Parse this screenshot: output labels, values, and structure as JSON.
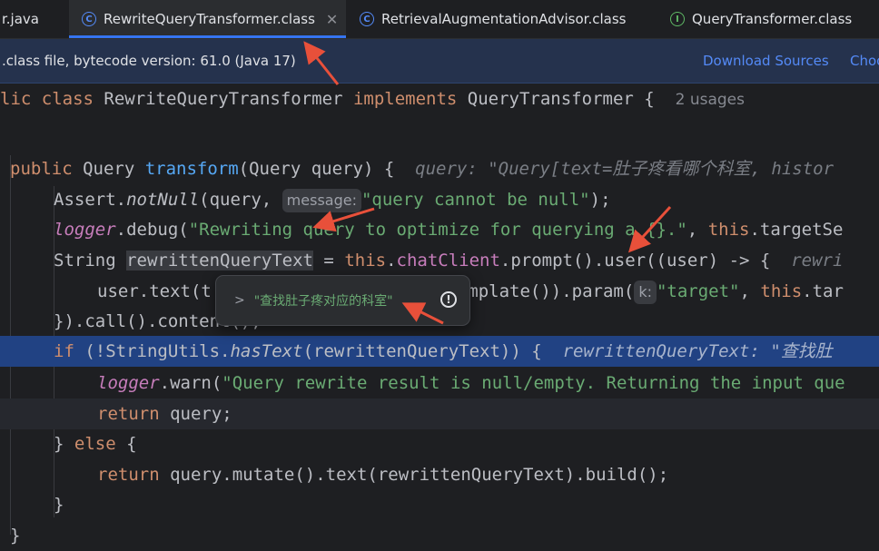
{
  "tabs": [
    {
      "label": "r.java",
      "icon": "java-file-icon"
    },
    {
      "label": "RewriteQueryTransformer.class",
      "icon": "class-icon",
      "active": true
    },
    {
      "label": "RetrievalAugmentationAdvisor.class",
      "icon": "class-icon"
    },
    {
      "label": "QueryTransformer.class",
      "icon": "interface-icon"
    }
  ],
  "infobar": {
    "message": ".class file, bytecode version: 61.0 (Java 17)",
    "download_sources": "Download Sources",
    "choose_sources": "Choo"
  },
  "code": {
    "l1": {
      "a": "lic ",
      "b": "class ",
      "c": "RewriteQueryTransformer ",
      "d": "implements ",
      "e": "QueryTransformer {",
      "usage": "2 usages"
    },
    "l3": {
      "a": "public ",
      "b": "Query ",
      "c": "transform",
      "d": "(Query query) {",
      "hint": "query: \"Query[text=肚子疼看哪个科室, histor"
    },
    "l4": {
      "a": "Assert.",
      "b": "notNull",
      "c": "(query, ",
      "chip": "message:",
      "d": "\"query cannot be null\"",
      "e": ");"
    },
    "l5": {
      "a": "logger",
      "b": ".debug(",
      "c": "\"Rewriting query to optimize for querying a {}.\"",
      "d": ", ",
      "e": "this",
      "f": ".targetSe"
    },
    "l6": {
      "a": "String ",
      "b": "rewrittenQueryText",
      "c": " = ",
      "d": "this",
      "e": ".",
      "f": "chatClient",
      "g": ".prompt().user((user) -> {",
      "hint": "rewri"
    },
    "l7": {
      "a": "user.text(t",
      "b": "emplate()).param(",
      "chip": "k:",
      "c": "\"target\"",
      "d": ", ",
      "e": "this",
      "f": ".tar"
    },
    "l8": {
      "a": "}).call().content();"
    },
    "l9": {
      "a": "if ",
      "b": "(!StringUtils.",
      "c": "hasText",
      "d": "(rewrittenQueryText)) {",
      "hint": "rewrittenQueryText: \"查找肚"
    },
    "l10": {
      "a": "logger",
      "b": ".warn(",
      "c": "\"Query rewrite result is null/empty. Returning the input que"
    },
    "l11": {
      "a": "return ",
      "b": "query;"
    },
    "l12": {
      "a": "} ",
      "b": "else ",
      "c": "{"
    },
    "l13": {
      "a": "return ",
      "b": "query.mutate().text(rewrittenQueryText).build();"
    },
    "l14": {
      "a": "}"
    },
    "l15": {
      "a": "}"
    }
  },
  "popup": {
    "chevron": ">",
    "value": "\"查找肚子疼对应的科室\"",
    "icon": "info-icon"
  },
  "colors": {
    "accent": "#3574f0",
    "selection": "#214283",
    "annotation_arrow": "#e8503a"
  }
}
